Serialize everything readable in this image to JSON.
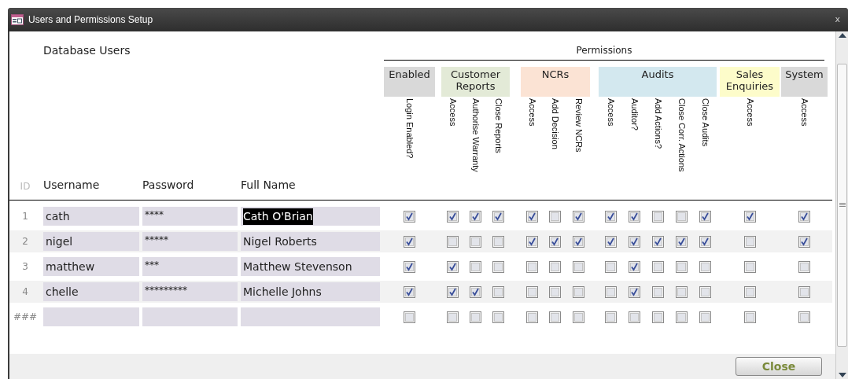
{
  "window": {
    "title": "Users and Permissions Setup",
    "close": "x"
  },
  "heading": "Database Users",
  "permissions_title": "Permissions",
  "columns": {
    "id": "ID",
    "username": "Username",
    "password": "Password",
    "full_name": "Full Name"
  },
  "permission_groups": [
    {
      "label": "Enabled",
      "color": "#d9d9d9",
      "columns": [
        "Login Enabled?"
      ]
    },
    {
      "label": "Customer Reports",
      "color": "#e3ead7",
      "columns": [
        "Access",
        "Authorise Warranty",
        "Close Reports"
      ]
    },
    {
      "label": "NCRs",
      "color": "#fbe3d4",
      "columns": [
        "Access",
        "Add Decision",
        "Review NCRs"
      ]
    },
    {
      "label": "Audits",
      "color": "#d3e8ef",
      "columns": [
        "Access",
        "Auditor?",
        "Add Actions?",
        "Close Corr. Actions",
        "Close Audits"
      ]
    },
    {
      "label": "Sales Enquiries",
      "color": "#fdfcca",
      "columns": [
        "Access"
      ]
    },
    {
      "label": "System",
      "color": "#d9d9d9",
      "columns": [
        "Access"
      ]
    }
  ],
  "rows": [
    {
      "id": "1",
      "username": "cath",
      "password": "****",
      "full_name": "Cath O'Brian",
      "text_selected": true,
      "checks": [
        true,
        true,
        true,
        true,
        true,
        false,
        true,
        true,
        true,
        false,
        false,
        true,
        true,
        true
      ]
    },
    {
      "id": "2",
      "username": "nigel",
      "password": "*****",
      "full_name": "Nigel Roberts",
      "checks": [
        true,
        false,
        false,
        false,
        true,
        true,
        true,
        true,
        true,
        true,
        true,
        true,
        false,
        true
      ]
    },
    {
      "id": "3",
      "username": "matthew",
      "password": "***",
      "full_name": "Matthew Stevenson",
      "checks": [
        true,
        true,
        false,
        false,
        false,
        false,
        false,
        false,
        true,
        false,
        false,
        false,
        false,
        false
      ]
    },
    {
      "id": "4",
      "username": "chelle",
      "password": "*********",
      "full_name": "Michelle Johns",
      "checks": [
        true,
        true,
        true,
        false,
        false,
        false,
        false,
        false,
        true,
        false,
        false,
        false,
        false,
        false
      ]
    },
    {
      "id": "###",
      "username": "",
      "password": "",
      "full_name": "",
      "checks": [
        false,
        false,
        false,
        false,
        false,
        false,
        false,
        false,
        false,
        false,
        false,
        false,
        false,
        false
      ]
    }
  ],
  "close_button": "Close"
}
